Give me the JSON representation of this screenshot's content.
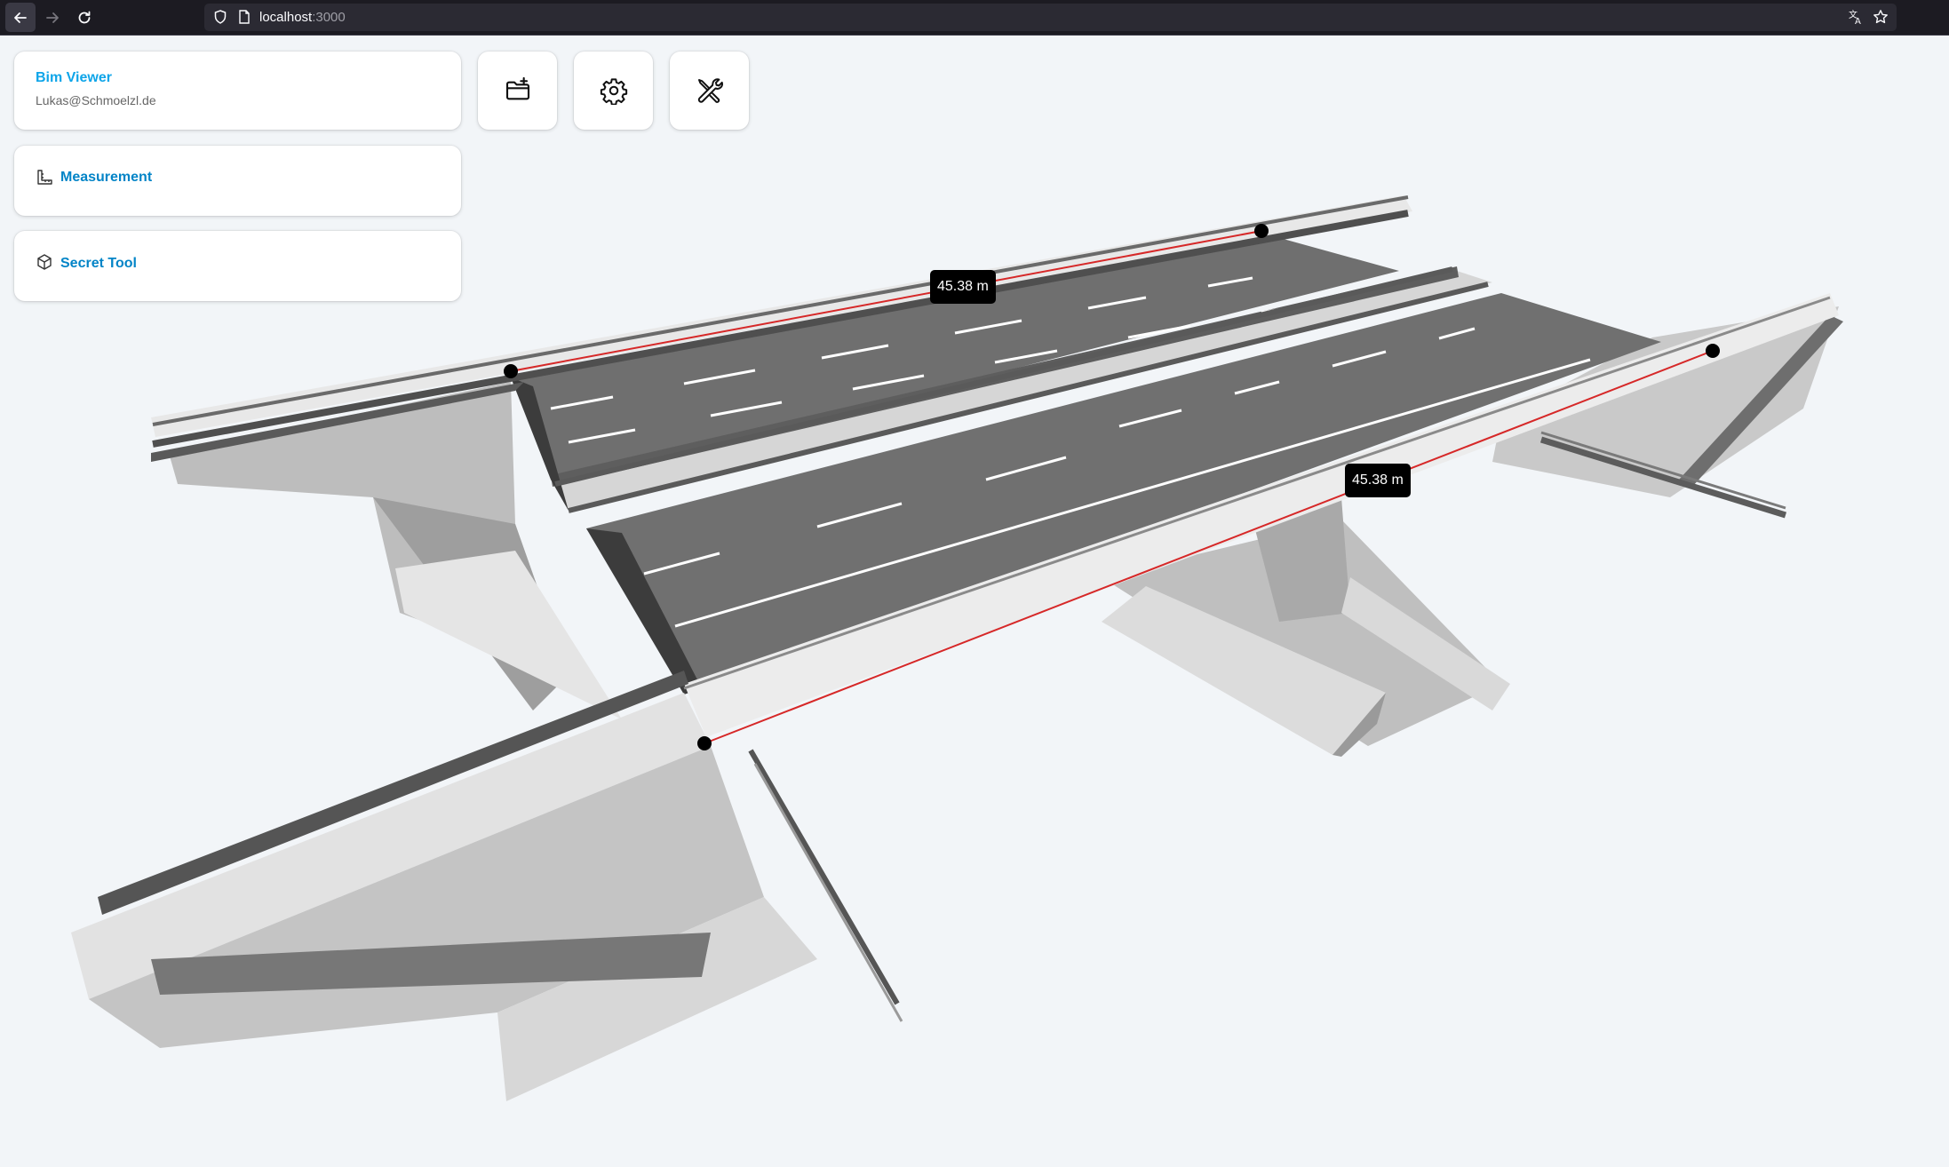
{
  "browser": {
    "url_host": "localhost",
    "url_port": ":3000"
  },
  "app": {
    "title": "Bim Viewer",
    "user_email": "Lukas@Schmoelzl.de"
  },
  "tools": [
    {
      "label": "Measurement",
      "icon": "ruler-corner-icon"
    },
    {
      "label": "Secret Tool",
      "icon": "cube-icon"
    }
  ],
  "toolbar": {
    "buttons": [
      {
        "name": "open-folder-button",
        "icon": "folder-plus-icon"
      },
      {
        "name": "settings-button",
        "icon": "gear-icon"
      },
      {
        "name": "tools-button",
        "icon": "wrench-screwdriver-icon"
      }
    ]
  },
  "measurements": [
    {
      "value_label": "45.38 m"
    },
    {
      "value_label": "45.38 m"
    }
  ],
  "colors": {
    "accent": "#0ea5e9",
    "measure_line": "#d62828",
    "road": "#6f6f6f",
    "concrete": "#c2c2c2"
  }
}
